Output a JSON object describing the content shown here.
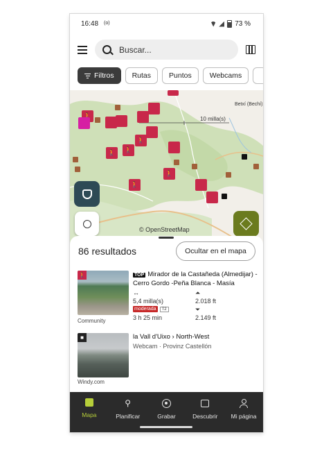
{
  "status_bar": {
    "time": "16:48",
    "signal_icon": "(o)",
    "battery": "73 %"
  },
  "search": {
    "placeholder": "Buscar..."
  },
  "chips": [
    {
      "label": "Filtros",
      "active": true
    },
    {
      "label": "Rutas",
      "active": false
    },
    {
      "label": "Puntos",
      "active": false
    },
    {
      "label": "Webcams",
      "active": false
    }
  ],
  "map": {
    "scale_label": "10 milla(s)",
    "place_label": "Betxí (Bechí)",
    "attribution": "© OpenStreetMap",
    "colors": {
      "forest": "#cfe0b8",
      "land": "#f2efe9",
      "road": "#e8c08a",
      "pin": "#c8284a",
      "pin_brown": "#a1603a",
      "layers_fab": "#6b7b1e",
      "dark_fab": "#2e4a55"
    }
  },
  "sheet": {
    "results_count": "86 resultados",
    "hide_map_button": "Ocultar en el mapa",
    "items": [
      {
        "tag": "TOP",
        "title": "Mirador de la Castañeda (Almedijar) -Cerro Gordo -Peña Blanca - Masía",
        "distance": "5,4 milla(s)",
        "duration": "3 h 25 min",
        "ascent": "2.018 ft",
        "descent": "2.149 ft",
        "difficulty": "moderada",
        "grade": "T2",
        "source": "Community",
        "icon": "hiker-icon"
      },
      {
        "title": "la Vall d'Uixo › North-West",
        "subtitle": "Webcam · Provinz Castellón",
        "source": "Windy.com",
        "icon": "camera-icon"
      }
    ]
  },
  "bottom_nav": [
    {
      "label": "Mapa",
      "active": true
    },
    {
      "label": "Planificar",
      "active": false
    },
    {
      "label": "Grabar",
      "active": false
    },
    {
      "label": "Descubrir",
      "active": false
    },
    {
      "label": "Mi página",
      "active": false
    }
  ]
}
